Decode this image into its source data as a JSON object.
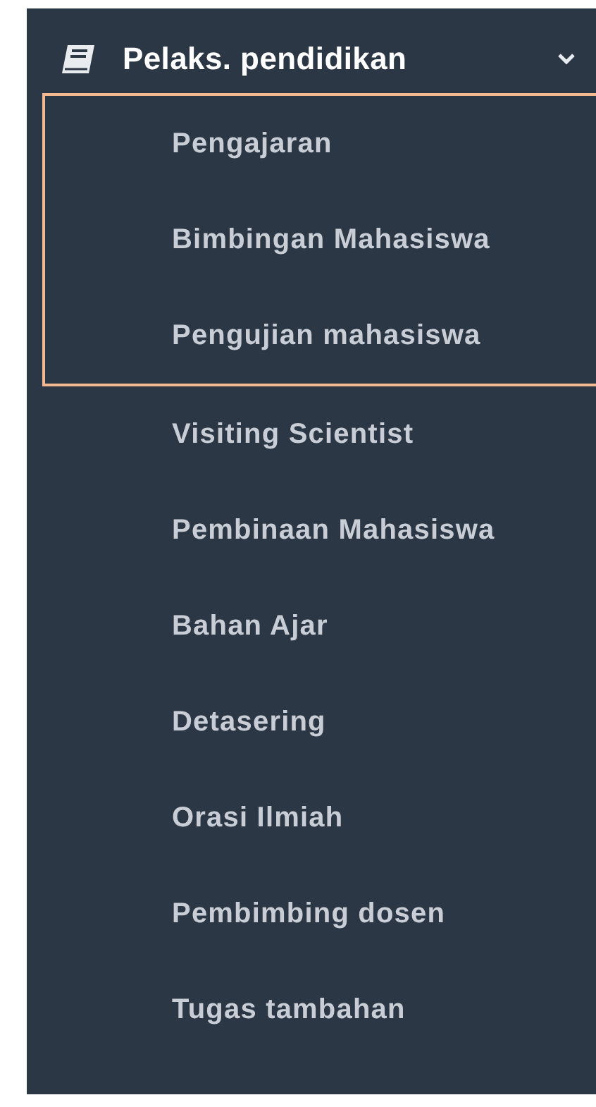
{
  "menu": {
    "title": "Pelaks. pendidikan",
    "expanded": true,
    "items": [
      {
        "label": "Pengajaran",
        "highlighted": true
      },
      {
        "label": "Bimbingan Mahasiswa",
        "highlighted": true
      },
      {
        "label": "Pengujian mahasiswa",
        "highlighted": true
      },
      {
        "label": "Visiting Scientist",
        "highlighted": false
      },
      {
        "label": "Pembinaan Mahasiswa",
        "highlighted": false
      },
      {
        "label": "Bahan Ajar",
        "highlighted": false
      },
      {
        "label": "Detasering",
        "highlighted": false
      },
      {
        "label": "Orasi Ilmiah",
        "highlighted": false
      },
      {
        "label": "Pembimbing dosen",
        "highlighted": false
      },
      {
        "label": "Tugas tambahan",
        "highlighted": false
      }
    ]
  }
}
